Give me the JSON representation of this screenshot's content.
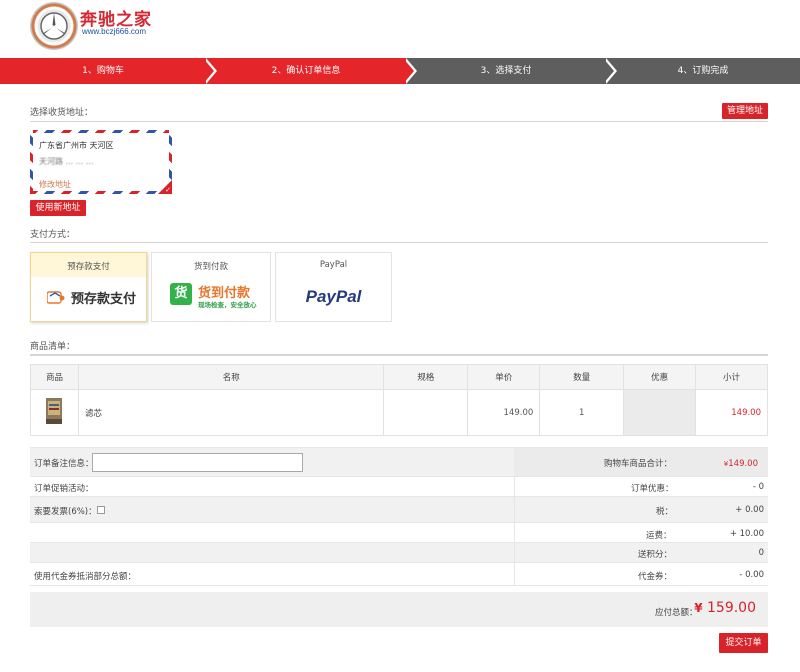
{
  "brand": {
    "title": "奔驰之家",
    "url": "www.bczj666.com"
  },
  "steps": [
    {
      "label": "1、购物车",
      "state": "active"
    },
    {
      "label": "2、确认订单信息",
      "state": "active"
    },
    {
      "label": "3、选择支付",
      "state": "inactive"
    },
    {
      "label": "4、订购完成",
      "state": "inactive"
    }
  ],
  "address": {
    "section_label": "选择收货地址：",
    "manage_button": "管理地址",
    "card_line1": "广东省广州市 天河区",
    "card_line2": "天河路 ...  ...  ...",
    "modify_link": "修改地址",
    "new_button": "使用新地址"
  },
  "payment": {
    "section_label": "支付方式：",
    "options": [
      {
        "name": "预存款支付",
        "logo_text": "预存款支付",
        "selected": true
      },
      {
        "name": "货到付款",
        "logo_text": "货到付款",
        "logo_sub": "现场检查，安全放心",
        "logo_glyph": "货",
        "selected": false
      },
      {
        "name": "PayPal",
        "logo_text": "PayPal",
        "selected": false
      }
    ]
  },
  "goods": {
    "section_label": "商品清单：",
    "headers": [
      "商品",
      "名称",
      "规格",
      "单价",
      "数量",
      "优惠",
      "小计"
    ],
    "rows": [
      {
        "name": "滤芯",
        "spec": "",
        "price": "149.00",
        "qty": "1",
        "discount": "",
        "subtotal": "149.00"
      }
    ]
  },
  "summary": {
    "note_label": "订单备注信息：",
    "note_value": "",
    "promo_label": "订单促销活动：",
    "invoice_label": "索要发票(6%)：",
    "voucher_label": "使用代金券抵消部分总额：",
    "lines": [
      {
        "label": "购物车商品合计：",
        "currency": "¥",
        "value": "149.00",
        "highlight": true
      },
      {
        "label": "订单优惠：",
        "value": "- 0"
      },
      {
        "label": "税：",
        "value": "+ 0.00"
      },
      {
        "label": "运费：",
        "value": "+ 10.00"
      },
      {
        "label": "送积分：",
        "value": "0"
      },
      {
        "label": "代金券：",
        "value": "- 0.00"
      }
    ],
    "total_label": "应付总额：",
    "total_currency": "¥",
    "total_value": "159.00",
    "submit_button": "提交订单"
  },
  "colors": {
    "accent": "#d8232a",
    "step_active": "#e4262b",
    "step_inactive": "#5e5e5e",
    "price": "#d8232a"
  }
}
